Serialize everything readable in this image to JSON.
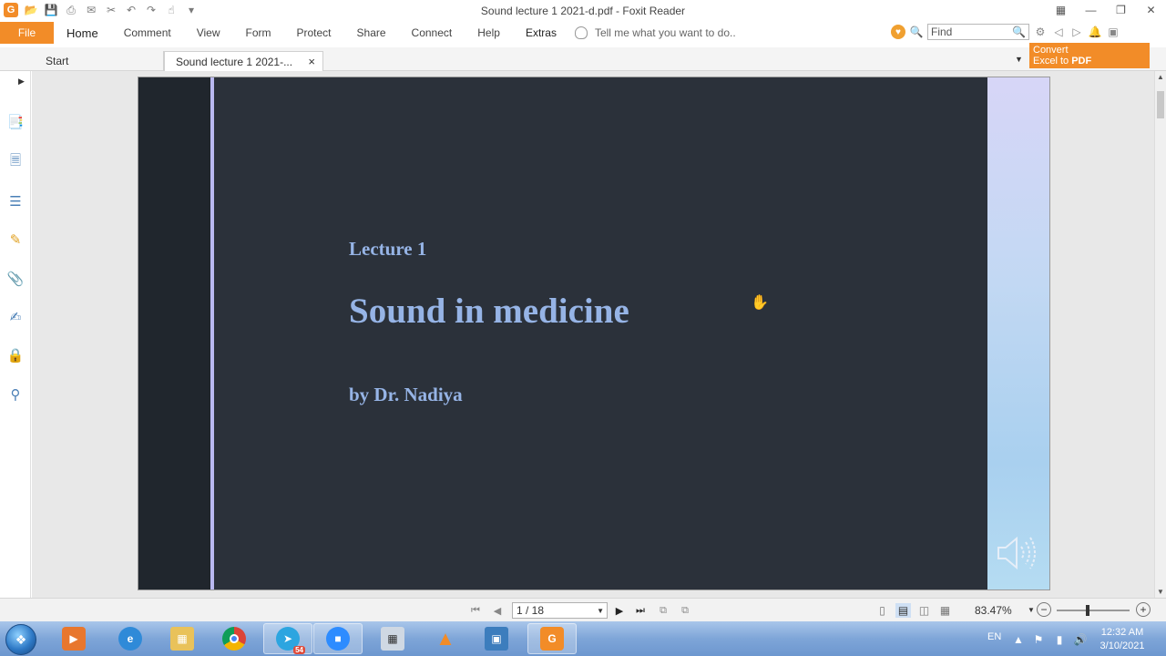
{
  "window": {
    "title": "Sound lecture 1 2021-d.pdf - Foxit Reader",
    "app_logo_letter": "G"
  },
  "ribbon": {
    "file_label": "File",
    "tabs": [
      "Home",
      "Comment",
      "View",
      "Form",
      "Protect",
      "Share",
      "Connect",
      "Help",
      "Extras"
    ],
    "tell_me_placeholder": "Tell me what you want to do..",
    "find_placeholder": "Find"
  },
  "doc_tabs": {
    "start_label": "Start",
    "current_label": "Sound lecture 1 2021-...",
    "close_glyph": "×"
  },
  "promo": {
    "line1": "Convert",
    "line2_prefix": "Excel to ",
    "line2_bold": "PDF"
  },
  "slide": {
    "subtitle": "Lecture 1",
    "title": "Sound in medicine",
    "author": "by Dr. Nadiya"
  },
  "status": {
    "page_indicator": "1 / 18",
    "zoom": "83.47%",
    "zoom_fraction": 0.42
  },
  "taskbar": {
    "language": "EN",
    "time": "12:32 AM",
    "date": "3/10/2021",
    "telegram_badge": "54"
  },
  "colors": {
    "accent_orange": "#f28c28",
    "slide_background": "#2b313a",
    "slide_text": "#96b4e6",
    "slide_accent_line": "#b9b8f0",
    "taskbar": "#7ea5d8"
  },
  "icons": {
    "left_panel": [
      "bookmark-icon",
      "pages-icon",
      "layers-icon",
      "comments-icon",
      "attachments-icon",
      "signatures-icon",
      "security-icon",
      "digital-id-icon"
    ]
  }
}
